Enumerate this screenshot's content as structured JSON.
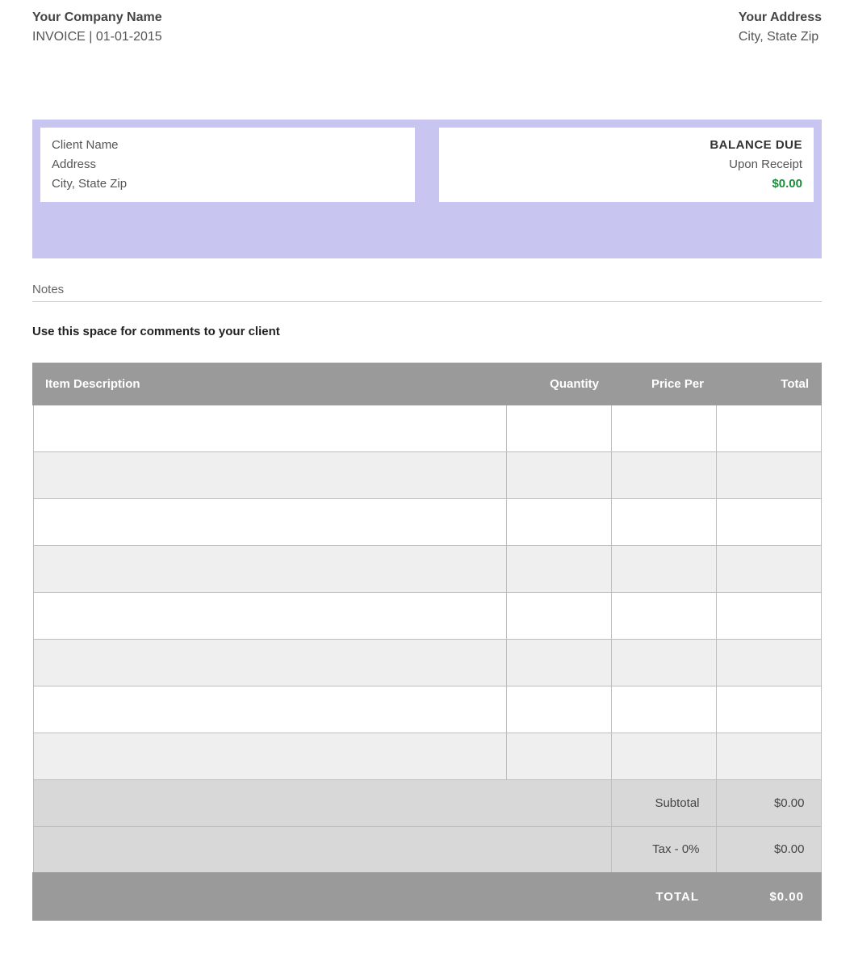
{
  "header": {
    "company_name": "Your Company Name",
    "invoice_line": "INVOICE | 01-01-2015",
    "your_address": "Your Address",
    "your_city_state_zip": "City, State Zip"
  },
  "client": {
    "name": "Client Name",
    "address": "Address",
    "city_state_zip": "City, State Zip"
  },
  "balance": {
    "label": "BALANCE DUE",
    "terms": "Upon Receipt",
    "amount": "$0.00"
  },
  "notes": {
    "label": "Notes",
    "text": "Use this space for comments to your client"
  },
  "table": {
    "headers": {
      "description": "Item Description",
      "quantity": "Quantity",
      "price_per": "Price Per",
      "total": "Total"
    },
    "rows": [
      {
        "description": "",
        "quantity": "",
        "price_per": "",
        "total": ""
      },
      {
        "description": "",
        "quantity": "",
        "price_per": "",
        "total": ""
      },
      {
        "description": "",
        "quantity": "",
        "price_per": "",
        "total": ""
      },
      {
        "description": "",
        "quantity": "",
        "price_per": "",
        "total": ""
      },
      {
        "description": "",
        "quantity": "",
        "price_per": "",
        "total": ""
      },
      {
        "description": "",
        "quantity": "",
        "price_per": "",
        "total": ""
      },
      {
        "description": "",
        "quantity": "",
        "price_per": "",
        "total": ""
      },
      {
        "description": "",
        "quantity": "",
        "price_per": "",
        "total": ""
      }
    ],
    "subtotal_label": "Subtotal",
    "subtotal_value": "$0.00",
    "tax_label": "Tax - 0%",
    "tax_value": "$0.00",
    "total_label": "TOTAL",
    "total_value": "$0.00"
  }
}
